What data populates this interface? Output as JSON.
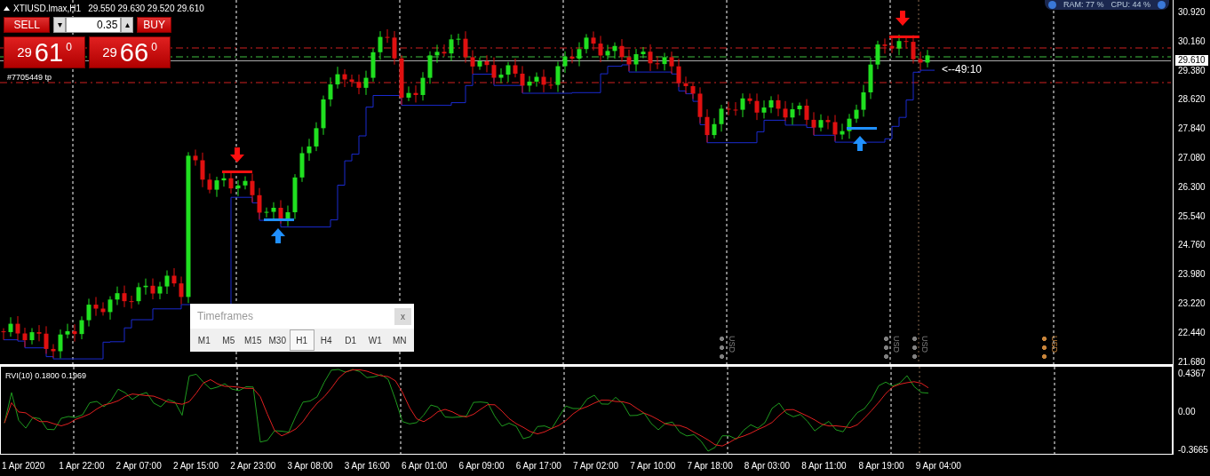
{
  "header": {
    "symbol": "XTIUSD.lmax,H1",
    "ohlc": "29.550 29.630 29.520 29.610"
  },
  "system_monitor": {
    "ram": "RAM: 77 %",
    "cpu": "CPU: 44 %"
  },
  "trade_panel": {
    "sell": {
      "label": "SELL",
      "price_small": "29",
      "price_big": "61",
      "price_sup": "0"
    },
    "lot": "0.35",
    "down": "▾",
    "up": "▴",
    "buy": {
      "label": "BUY",
      "price_small": "29",
      "price_big": "66",
      "price_sup": "0"
    }
  },
  "order_label": "#7705449 tp",
  "countdown": "<--49:10",
  "price_axis": [
    "30.920",
    "30.160",
    "29.380",
    "28.620",
    "27.840",
    "27.080",
    "26.300",
    "25.540",
    "24.760",
    "23.980",
    "23.220",
    "22.440",
    "21.680"
  ],
  "current_price": "29.610",
  "events": [
    {
      "label": "USD",
      "color": "#808080"
    },
    {
      "label": "USD",
      "color": "#808080"
    },
    {
      "label": "USD",
      "color": "#808080"
    },
    {
      "label": "USD",
      "color": "#c8843a"
    }
  ],
  "timeframes": {
    "title": "Timeframes",
    "close": "x",
    "items": [
      {
        "label": "M1",
        "selected": false
      },
      {
        "label": "M5",
        "selected": false
      },
      {
        "label": "M15",
        "selected": false
      },
      {
        "label": "M30",
        "selected": false
      },
      {
        "label": "H1",
        "selected": true
      },
      {
        "label": "H4",
        "selected": false
      },
      {
        "label": "D1",
        "selected": false
      },
      {
        "label": "W1",
        "selected": false
      },
      {
        "label": "MN",
        "selected": false
      }
    ]
  },
  "indicator": {
    "label": "RVI(10) 0.1800 0.1969",
    "axis": [
      "0.4367",
      "0.00",
      "-0.3665"
    ]
  },
  "time_axis": [
    "1 Apr 2020",
    "1 Apr 22:00",
    "2 Apr 07:00",
    "2 Apr 15:00",
    "2 Apr 23:00",
    "3 Apr 08:00",
    "3 Apr 16:00",
    "6 Apr 01:00",
    "6 Apr 09:00",
    "6 Apr 17:00",
    "7 Apr 02:00",
    "7 Apr 10:00",
    "7 Apr 18:00",
    "8 Apr 03:00",
    "8 Apr 11:00",
    "8 Apr 19:00",
    "9 Apr 04:00"
  ]
}
